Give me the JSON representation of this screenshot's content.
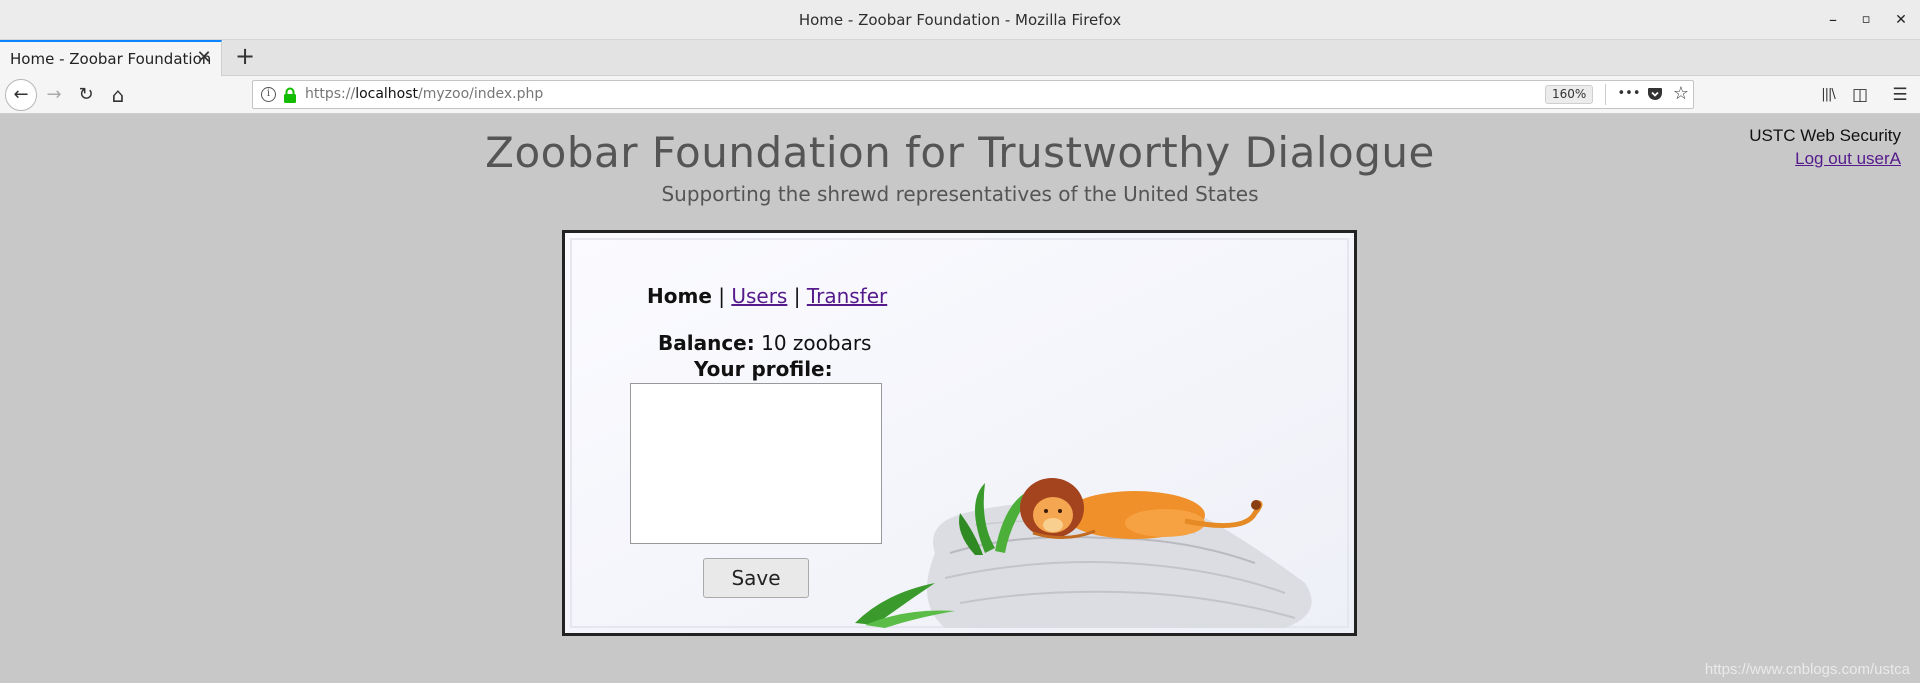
{
  "window": {
    "title": "Home - Zoobar Foundation - Mozilla Firefox",
    "minimize": "–",
    "maximize": "▫",
    "close": "✕"
  },
  "tab": {
    "title": "Home - Zoobar Foundation",
    "close": "✕",
    "new_tab": "+"
  },
  "navbar": {
    "back": "←",
    "forward": "→",
    "reload": "↻",
    "home": "⌂",
    "url_scheme": "https://",
    "url_host": "localhost",
    "url_path": "/myzoo/index.php",
    "zoom": "160%",
    "more": "•••",
    "pocket": "◆",
    "bookmark": "☆",
    "library": "|||\\",
    "sidebar": "◫",
    "menu": "☰"
  },
  "page": {
    "org": "USTC Web Security",
    "logout": "Log out userA",
    "title": "Zoobar Foundation for Trustworthy Dialogue",
    "subtitle": "Supporting the shrewd representatives of the United States",
    "nav": {
      "home": "Home",
      "sep": " | ",
      "users": "Users",
      "transfer": "Transfer"
    },
    "balance_label": "Balance:",
    "balance_value": "10 zoobars",
    "profile_label": "Your profile:",
    "profile_value": "",
    "save": "Save"
  },
  "watermark": "https://www.cnblogs.com/ustca"
}
